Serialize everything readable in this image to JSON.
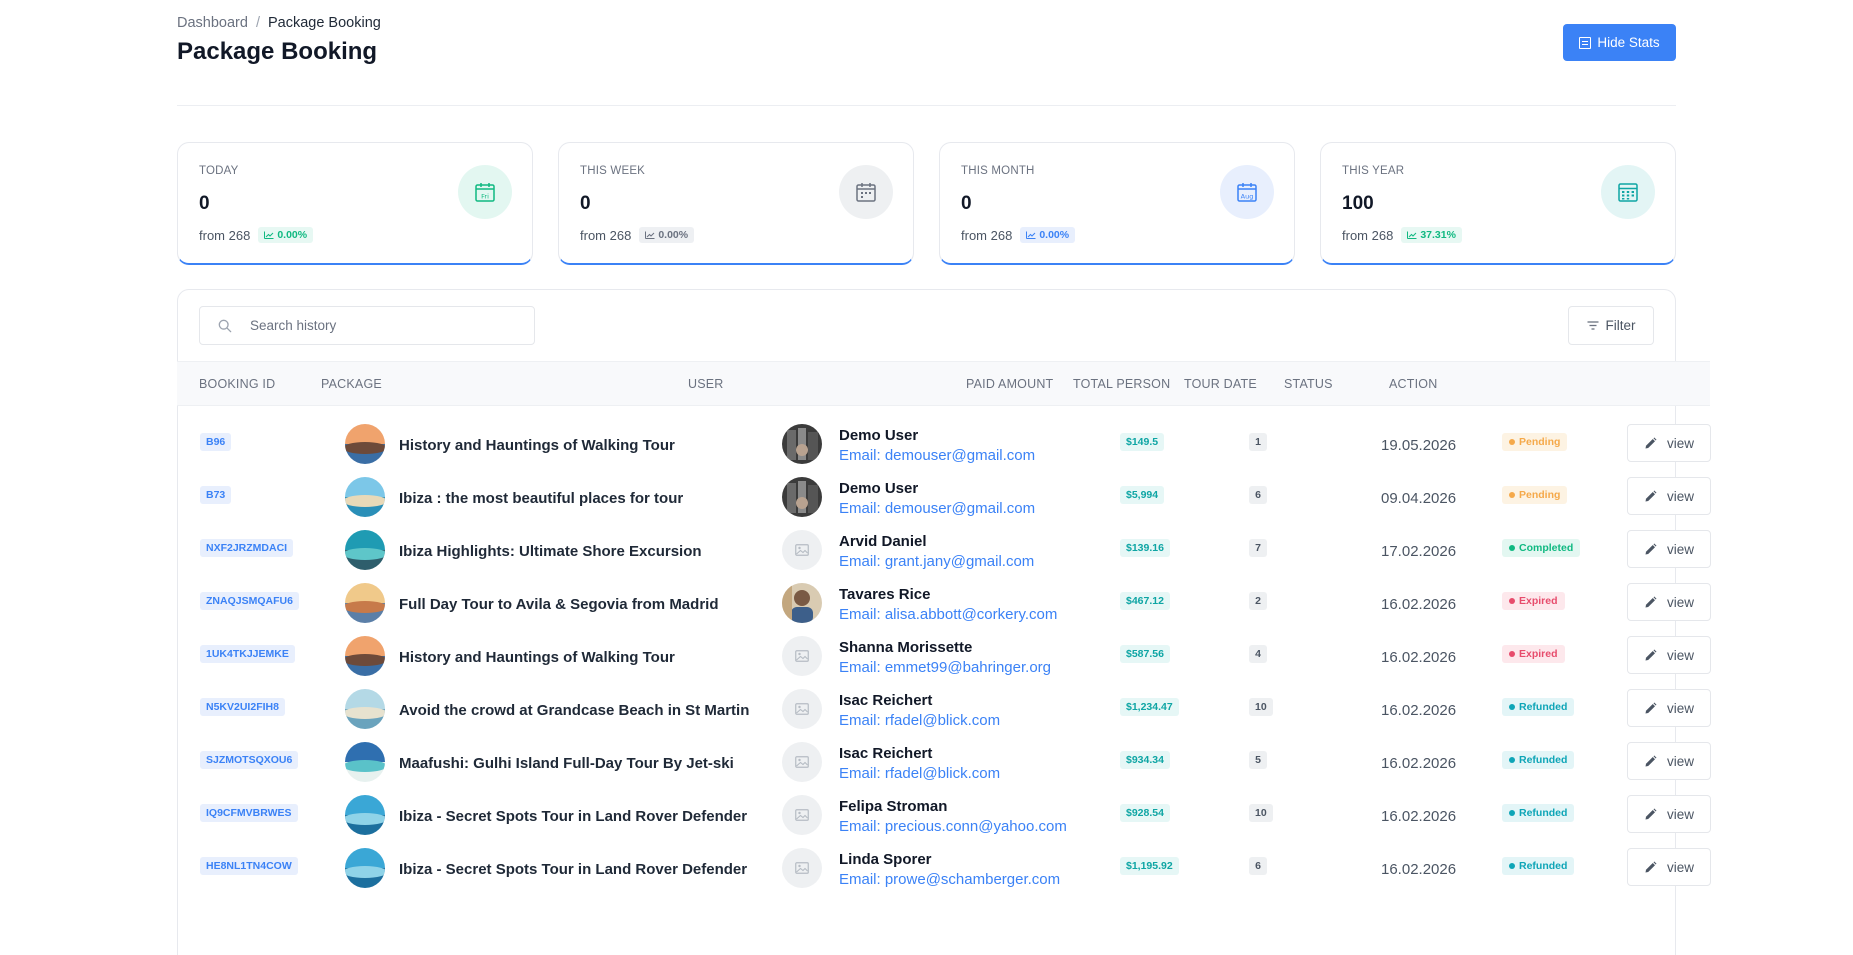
{
  "breadcrumb": {
    "root": "Dashboard",
    "separator": "/",
    "current": "Package Booking"
  },
  "page_title": "Package Booking",
  "header": {
    "hide_stats_label": "Hide Stats"
  },
  "colors": {
    "primary": "#3b82f6",
    "success": "#10b981",
    "danger": "#ef4444",
    "warning": "#f59e0b",
    "info": "#06b6d4"
  },
  "stats": [
    {
      "label": "TODAY",
      "value": "0",
      "from": "from 268",
      "pct": "0.00%",
      "icon": "calendar-day-icon",
      "icon_text": "Fri",
      "trend": "up"
    },
    {
      "label": "THIS WEEK",
      "value": "0",
      "from": "from 268",
      "pct": "0.00%",
      "icon": "calendar-week-icon",
      "icon_text": "",
      "trend": "neutral"
    },
    {
      "label": "THIS MONTH",
      "value": "0",
      "from": "from 268",
      "pct": "0.00%",
      "icon": "calendar-month-icon",
      "icon_text": "Aug",
      "trend": "neutral-blue"
    },
    {
      "label": "THIS YEAR",
      "value": "100",
      "from": "from 268",
      "pct": "37.31%",
      "icon": "calendar-year-icon",
      "icon_text": "",
      "trend": "up"
    }
  ],
  "search": {
    "placeholder": "Search history"
  },
  "filter": {
    "label": "Filter"
  },
  "table": {
    "headers": [
      "BOOKING ID",
      "PACKAGE",
      "USER",
      "PAID AMOUNT",
      "TOTAL PERSON",
      "TOUR DATE",
      "STATUS",
      "ACTION"
    ],
    "rows": [
      {
        "id": "B96",
        "package": "History and Hauntings of Walking Tour",
        "user": "Demo User",
        "email": "Email: demouser@gmail.com",
        "amount": "$149.5",
        "persons": "1",
        "date": "19.05.2026",
        "status": "Pending",
        "action": "view",
        "avatar": "photo",
        "pkg_theme": "warm"
      },
      {
        "id": "B73",
        "package": "Ibiza : the most beautiful places for tour",
        "user": "Demo User",
        "email": "Email: demouser@gmail.com",
        "amount": "$5,994",
        "persons": "6",
        "date": "09.04.2026",
        "status": "Pending",
        "action": "view",
        "avatar": "photo",
        "pkg_theme": "beach"
      },
      {
        "id": "NXF2JRZMDACI",
        "package": "Ibiza Highlights: Ultimate Shore Excursion",
        "user": "Arvid Daniel",
        "email": "Email: grant.jany@gmail.com",
        "amount": "$139.16",
        "persons": "7",
        "date": "17.02.2026",
        "status": "Completed",
        "action": "view",
        "avatar": "placeholder",
        "pkg_theme": "sea"
      },
      {
        "id": "ZNAQJSMQAFU6",
        "package": "Full Day Tour to Avila & Segovia from Madrid",
        "user": "Tavares Rice",
        "email": "Email: alisa.abbott@corkery.com",
        "amount": "$467.12",
        "persons": "2",
        "date": "16.02.2026",
        "status": "Expired",
        "action": "view",
        "avatar": "photo2",
        "pkg_theme": "sunset"
      },
      {
        "id": "1UK4TKJJEMKE",
        "package": "History and Hauntings of Walking Tour",
        "user": "Shanna Morissette",
        "email": "Email: emmet99@bahringer.org",
        "amount": "$587.56",
        "persons": "4",
        "date": "16.02.2026",
        "status": "Expired",
        "action": "view",
        "avatar": "placeholder",
        "pkg_theme": "warm"
      },
      {
        "id": "N5KV2UI2FIH8",
        "package": "Avoid the crowd at Grandcase Beach in St Martin",
        "user": "Isac Reichert",
        "email": "Email: rfadel@blick.com",
        "amount": "$1,234.47",
        "persons": "10",
        "date": "16.02.2026",
        "status": "Refunded",
        "action": "view",
        "avatar": "placeholder",
        "pkg_theme": "shore"
      },
      {
        "id": "SJZMOTSQXOU6",
        "package": "Maafushi: Gulhi Island Full-Day Tour By Jet-ski",
        "user": "Isac Reichert",
        "email": "Email: rfadel@blick.com",
        "amount": "$934.34",
        "persons": "5",
        "date": "16.02.2026",
        "status": "Refunded",
        "action": "view",
        "avatar": "placeholder",
        "pkg_theme": "island"
      },
      {
        "id": "IQ9CFMVBRWES",
        "package": "Ibiza - Secret Spots Tour in Land Rover Defender",
        "user": "Felipa Stroman",
        "email": "Email: precious.conn@yahoo.com",
        "amount": "$928.54",
        "persons": "10",
        "date": "16.02.2026",
        "status": "Refunded",
        "action": "view",
        "avatar": "placeholder",
        "pkg_theme": "ocean"
      },
      {
        "id": "HE8NL1TN4COW",
        "package": "Ibiza - Secret Spots Tour in Land Rover Defender",
        "user": "Linda Sporer",
        "email": "Email: prowe@schamberger.com",
        "amount": "$1,195.92",
        "persons": "6",
        "date": "16.02.2026",
        "status": "Refunded",
        "action": "view",
        "avatar": "placeholder",
        "pkg_theme": "ocean"
      }
    ]
  }
}
